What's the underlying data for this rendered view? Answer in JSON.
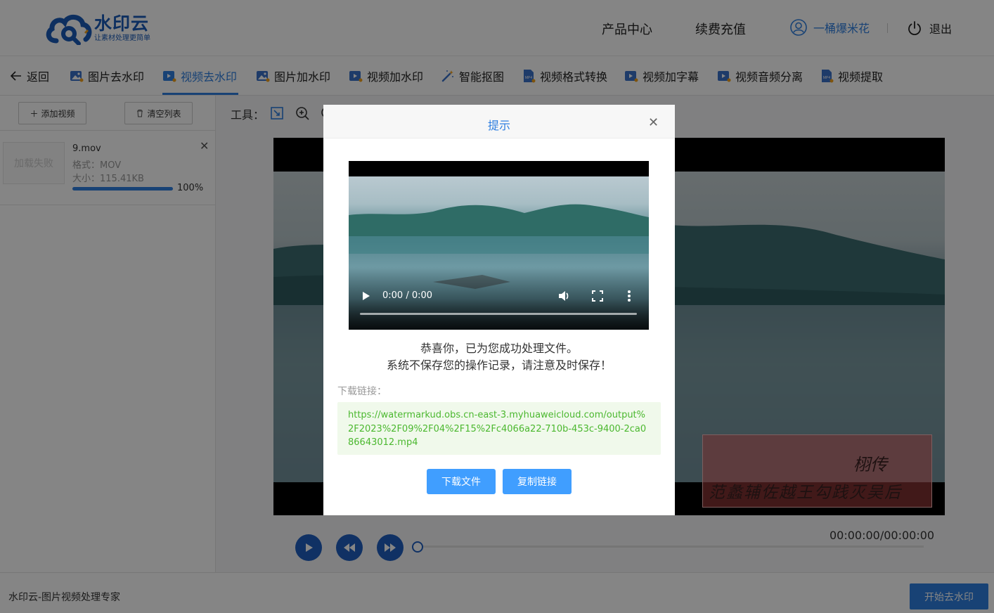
{
  "header": {
    "logo": {
      "name": "水印云",
      "slogan": "让素材处理更简单"
    },
    "nav": [
      "产品中心",
      "续费充值"
    ],
    "user": {
      "name": "一桶爆米花",
      "icon": "user-circle-icon"
    },
    "logout": {
      "label": "退出",
      "icon": "power-icon"
    }
  },
  "tabs": {
    "back": "返回",
    "items": [
      {
        "label": "图片去水印",
        "icon": "image-icon"
      },
      {
        "label": "视频去水印",
        "icon": "video-icon",
        "active": true
      },
      {
        "label": "图片加水印",
        "icon": "image-icon"
      },
      {
        "label": "视频加水印",
        "icon": "video-icon"
      },
      {
        "label": "智能抠图",
        "icon": "magic-wand-icon"
      },
      {
        "label": "视频格式转换",
        "icon": "mp4-file-icon"
      },
      {
        "label": "视频加字幕",
        "icon": "video-icon"
      },
      {
        "label": "视频音频分离",
        "icon": "video-icon"
      },
      {
        "label": "视频提取",
        "icon": "mp4-file-icon"
      }
    ]
  },
  "left": {
    "add_video": "添加视频",
    "clear_list": "清空列表",
    "file": {
      "thumb_text": "加载失败",
      "name": "9.mov",
      "format": "格式：MOV",
      "size": "大小：115.41KB",
      "progress": 1.0,
      "progress_text": "100%"
    }
  },
  "tools": {
    "label": "工具："
  },
  "player": {
    "time": "00:00:00/00:00:00"
  },
  "watermark": {
    "line1": "栩传",
    "line2": "范蠡辅佐越王勾践灭吴后"
  },
  "footer": {
    "text": "水印云-图片视频处理专家",
    "start": "开始去水印"
  },
  "modal": {
    "title": "提示",
    "video_time": "0:00 / 0:00",
    "msg1": "恭喜你，已为您成功处理文件。",
    "msg2": "系统不保存您的操作记录，请注意及时保存！",
    "dl_label": "下载链接：",
    "dl_url": "https://watermarkud.obs.cn-east-3.myhuaweicloud.com/output%2F2023%2F09%2F04%2F15%2Fc4066a22-710b-453c-9400-2ca086643012.mp4",
    "download": "下载文件",
    "copy": "复制链接"
  },
  "colors": {
    "accent": "#2f7fe0",
    "brand": "#1a5bb8",
    "success_text": "#4bb82f",
    "button": "#409eff"
  }
}
